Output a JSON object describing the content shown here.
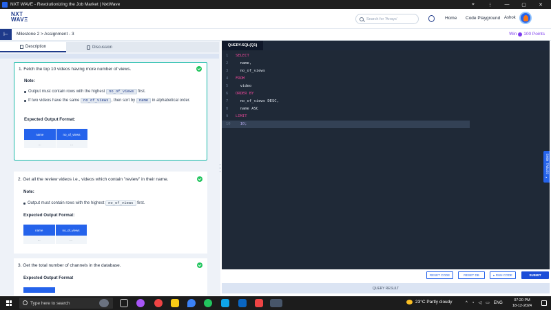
{
  "browser": {
    "title": "NXT WAVE - Revolutionizing the Job Market | NxtWave",
    "controls": [
      "⌖",
      "⋮",
      "—",
      "▢",
      "✕"
    ]
  },
  "header": {
    "logo_line1": "NXT",
    "logo_line2": "WAVΞ",
    "search_placeholder": "Search for 'Arrays'",
    "nav": [
      "Home",
      "Code Playground"
    ],
    "user_name": "Ashok"
  },
  "milestone": {
    "breadcrumb": "Milestone 2 > Assignment - 3",
    "win_label": "Win",
    "points": "100 Points"
  },
  "tabs": {
    "description": "Description",
    "discussion": "Discussion"
  },
  "questions": [
    {
      "title": "1.  Fetch the top 10 videos having more number of views.",
      "note": "Note:",
      "bullet1_pre": "Output must contain rows with the highest ",
      "bullet1_code": "no_of_views",
      "bullet1_post": " first.",
      "bullet2_pre": "If two videos have the same ",
      "bullet2_code": "no_of_views",
      "bullet2_mid": ", then sort by ",
      "bullet2_code2": "name",
      "bullet2_post": " in alphabetical order.",
      "expected": "Expected Output Format:",
      "columns": [
        "name",
        "no_of_views"
      ],
      "cells": [
        "...",
        "..."
      ]
    },
    {
      "title": "2.  Get all the review videos i.e., videos which contain \"review\" in their name.",
      "note": "Note:",
      "bullet1_pre": "Output must contain rows with the highest ",
      "bullet1_code": "no_of_views",
      "bullet1_post": " first.",
      "expected": "Expected Output Format:",
      "columns": [
        "name",
        "no_of_views"
      ],
      "cells": [
        "...",
        "..."
      ]
    },
    {
      "title": "3.  Get the total number of channels in the database.",
      "expected": "Expected Output Format"
    }
  ],
  "editor": {
    "tab": "QUERY.SQL(Q1)",
    "lines": [
      {
        "n": "1",
        "text": "SELECT",
        "color": "#ec4899"
      },
      {
        "n": "2",
        "text": "  name,",
        "color": "#e2e8f0"
      },
      {
        "n": "3",
        "text": "  no_of_views",
        "color": "#e2e8f0"
      },
      {
        "n": "4",
        "text": "FROM",
        "color": "#ec4899"
      },
      {
        "n": "5",
        "text": "  video",
        "color": "#e2e8f0"
      },
      {
        "n": "6",
        "text": "ORDER BY",
        "color": "#ec4899"
      },
      {
        "n": "7",
        "text": "  no_of_views DESC,",
        "color": "#e2e8f0"
      },
      {
        "n": "8",
        "text": "  name ASC",
        "color": "#e2e8f0"
      },
      {
        "n": "9",
        "text": "LIMIT",
        "color": "#ec4899"
      },
      {
        "n": "10",
        "text": "  10;",
        "color": "#c4b5fd"
      }
    ],
    "show_tables": "SHOW TABLES ▸",
    "buttons": {
      "reset_code": "RESET CODE",
      "reset_db": "RESET DB",
      "run_code": "▸ RUN CODE",
      "submit": "SUBMIT"
    },
    "query_result": "QUERY RESULT"
  },
  "taskbar": {
    "search": "Type here to search",
    "weather": "23°C  Partly cloudy",
    "lang": "ENG",
    "time": "07:20 PM",
    "date": "18-12-2024"
  }
}
